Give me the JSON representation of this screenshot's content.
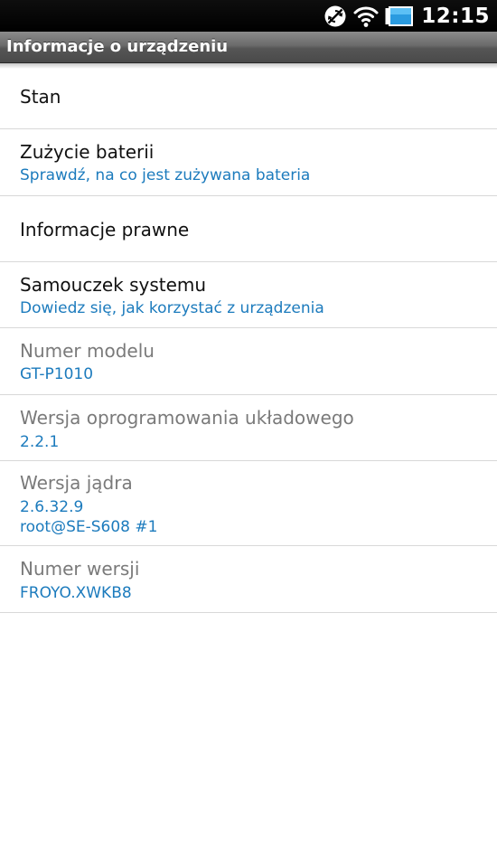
{
  "status_bar": {
    "time": "12:15",
    "icons": [
      "sync-off-icon",
      "wifi-icon",
      "battery-icon"
    ]
  },
  "header": {
    "title": "Informacje o urządzeniu"
  },
  "items": [
    {
      "title": "Stan"
    },
    {
      "title": "Zużycie baterii",
      "summary": "Sprawdź, na co jest zużywana bateria"
    },
    {
      "title": "Informacje prawne"
    },
    {
      "title": "Samouczek systemu",
      "summary": "Dowiedz się, jak korzystać z urządzenia"
    },
    {
      "title": "Numer modelu",
      "summary": "GT-P1010"
    },
    {
      "title": "Wersja oprogramowania układowego",
      "summary": "2.2.1"
    },
    {
      "title": "Wersja jądra",
      "summary": "2.6.32.9",
      "summary_line2": "root@SE-S608 #1"
    },
    {
      "title": "Numer wersji",
      "summary": "FROYO.XWKB8"
    }
  ],
  "colors": {
    "summary_text": "#1c7bbd",
    "enabled_title": "#111111",
    "disabled_title": "#7a7a7a",
    "divider": "#d8d8d8",
    "status_bar_bg": "#000000",
    "battery_fill": "#2a9be0"
  }
}
